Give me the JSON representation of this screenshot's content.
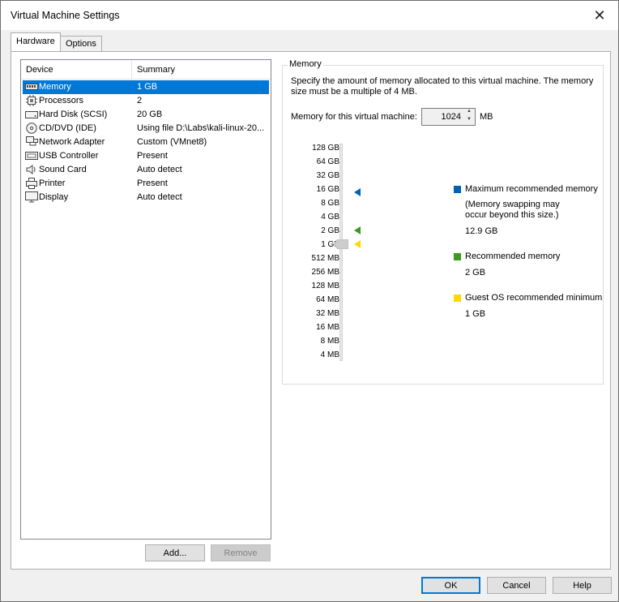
{
  "window": {
    "title": "Virtual Machine Settings"
  },
  "tabs": [
    {
      "label": "Hardware"
    },
    {
      "label": "Options"
    }
  ],
  "device_list": {
    "headers": {
      "device": "Device",
      "summary": "Summary"
    },
    "rows": [
      {
        "icon": "memory-icon",
        "device": "Memory",
        "summary": "1 GB"
      },
      {
        "icon": "processor-icon",
        "device": "Processors",
        "summary": "2"
      },
      {
        "icon": "hard-disk-icon",
        "device": "Hard Disk (SCSI)",
        "summary": "20 GB"
      },
      {
        "icon": "cd-dvd-icon",
        "device": "CD/DVD (IDE)",
        "summary": "Using file D:\\Labs\\kali-linux-20..."
      },
      {
        "icon": "network-adapter-icon",
        "device": "Network Adapter",
        "summary": "Custom (VMnet8)"
      },
      {
        "icon": "usb-icon",
        "device": "USB Controller",
        "summary": "Present"
      },
      {
        "icon": "sound-card-icon",
        "device": "Sound Card",
        "summary": "Auto detect"
      },
      {
        "icon": "printer-icon",
        "device": "Printer",
        "summary": "Present"
      },
      {
        "icon": "display-icon",
        "device": "Display",
        "summary": "Auto detect"
      }
    ]
  },
  "buttons": {
    "add": "Add...",
    "remove": "Remove",
    "ok": "OK",
    "cancel": "Cancel",
    "help": "Help"
  },
  "memory": {
    "group_title": "Memory",
    "description": "Specify the amount of memory allocated to this virtual machine. The memory size must be a multiple of 4 MB.",
    "field_label": "Memory for this virtual machine:",
    "value": "1024",
    "unit": "MB",
    "scale": [
      "128 GB",
      "64 GB",
      "32 GB",
      "16 GB",
      "8 GB",
      "4 GB",
      "2 GB",
      "1 GB",
      "512 MB",
      "256 MB",
      "128 MB",
      "64 MB",
      "32 MB",
      "16 MB",
      "8 MB",
      "4 MB"
    ],
    "legend": {
      "max": {
        "title": "Maximum recommended memory",
        "note": "(Memory swapping may occur beyond this size.)",
        "value": "12.9 GB",
        "color": "#0063b1"
      },
      "recommended": {
        "title": "Recommended memory",
        "value": "2 GB",
        "color": "#3c9a1c"
      },
      "guest_min": {
        "title": "Guest OS recommended minimum",
        "value": "1 GB",
        "color": "#ffd800"
      }
    }
  },
  "colors": {
    "selection": "#0078d7"
  }
}
